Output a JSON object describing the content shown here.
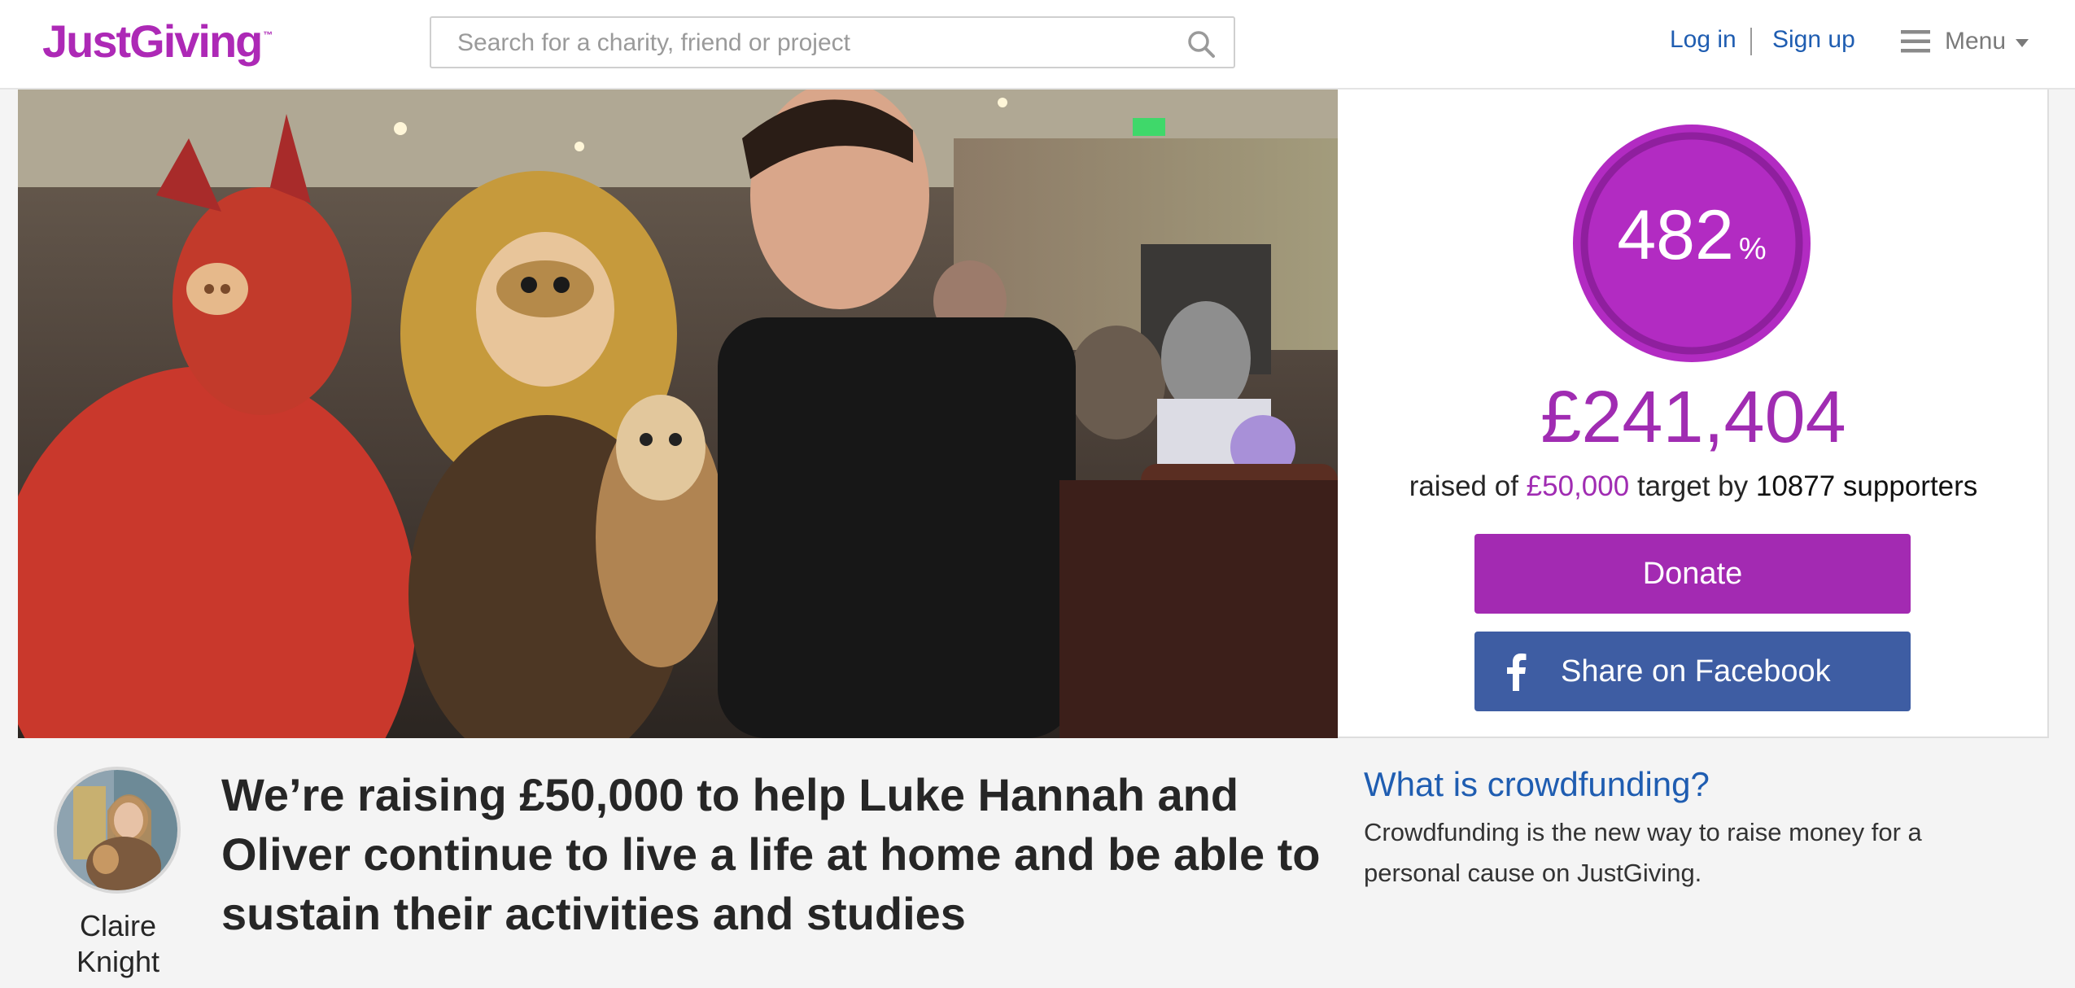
{
  "header": {
    "logo_text": "JustGiving",
    "logo_tm": "™",
    "search_placeholder": "Search for a charity, friend or project",
    "login_label": "Log in",
    "signup_label": "Sign up",
    "menu_label": "Menu",
    "icons": [
      "search-icon",
      "hamburger-icon",
      "caret-down-icon"
    ]
  },
  "totaliser": {
    "percent": "482",
    "percent_sign": "%",
    "raised": "£241,404",
    "raised_prefix": "raised of",
    "target": "£50,000",
    "target_mid": "target by",
    "supporters": "10877 supporters",
    "donate_label": "Donate",
    "facebook_label": "Share on Facebook"
  },
  "page": {
    "author_first": "Claire",
    "author_last": "Knight",
    "headline": "We’re raising £50,000 to help Luke Hannah and Oliver continue to live a life at home and be able to sustain their activities and studies",
    "crowdfunding_title": "What is crowdfunding?",
    "crowdfunding_body": "Crowdfunding is the new way to raise money for a personal cause on JustGiving."
  },
  "colors": {
    "brand_purple": "#ad29b6",
    "link_blue": "#1f5db1",
    "facebook_blue": "#3e5da3",
    "background": "#f4f4f4"
  }
}
